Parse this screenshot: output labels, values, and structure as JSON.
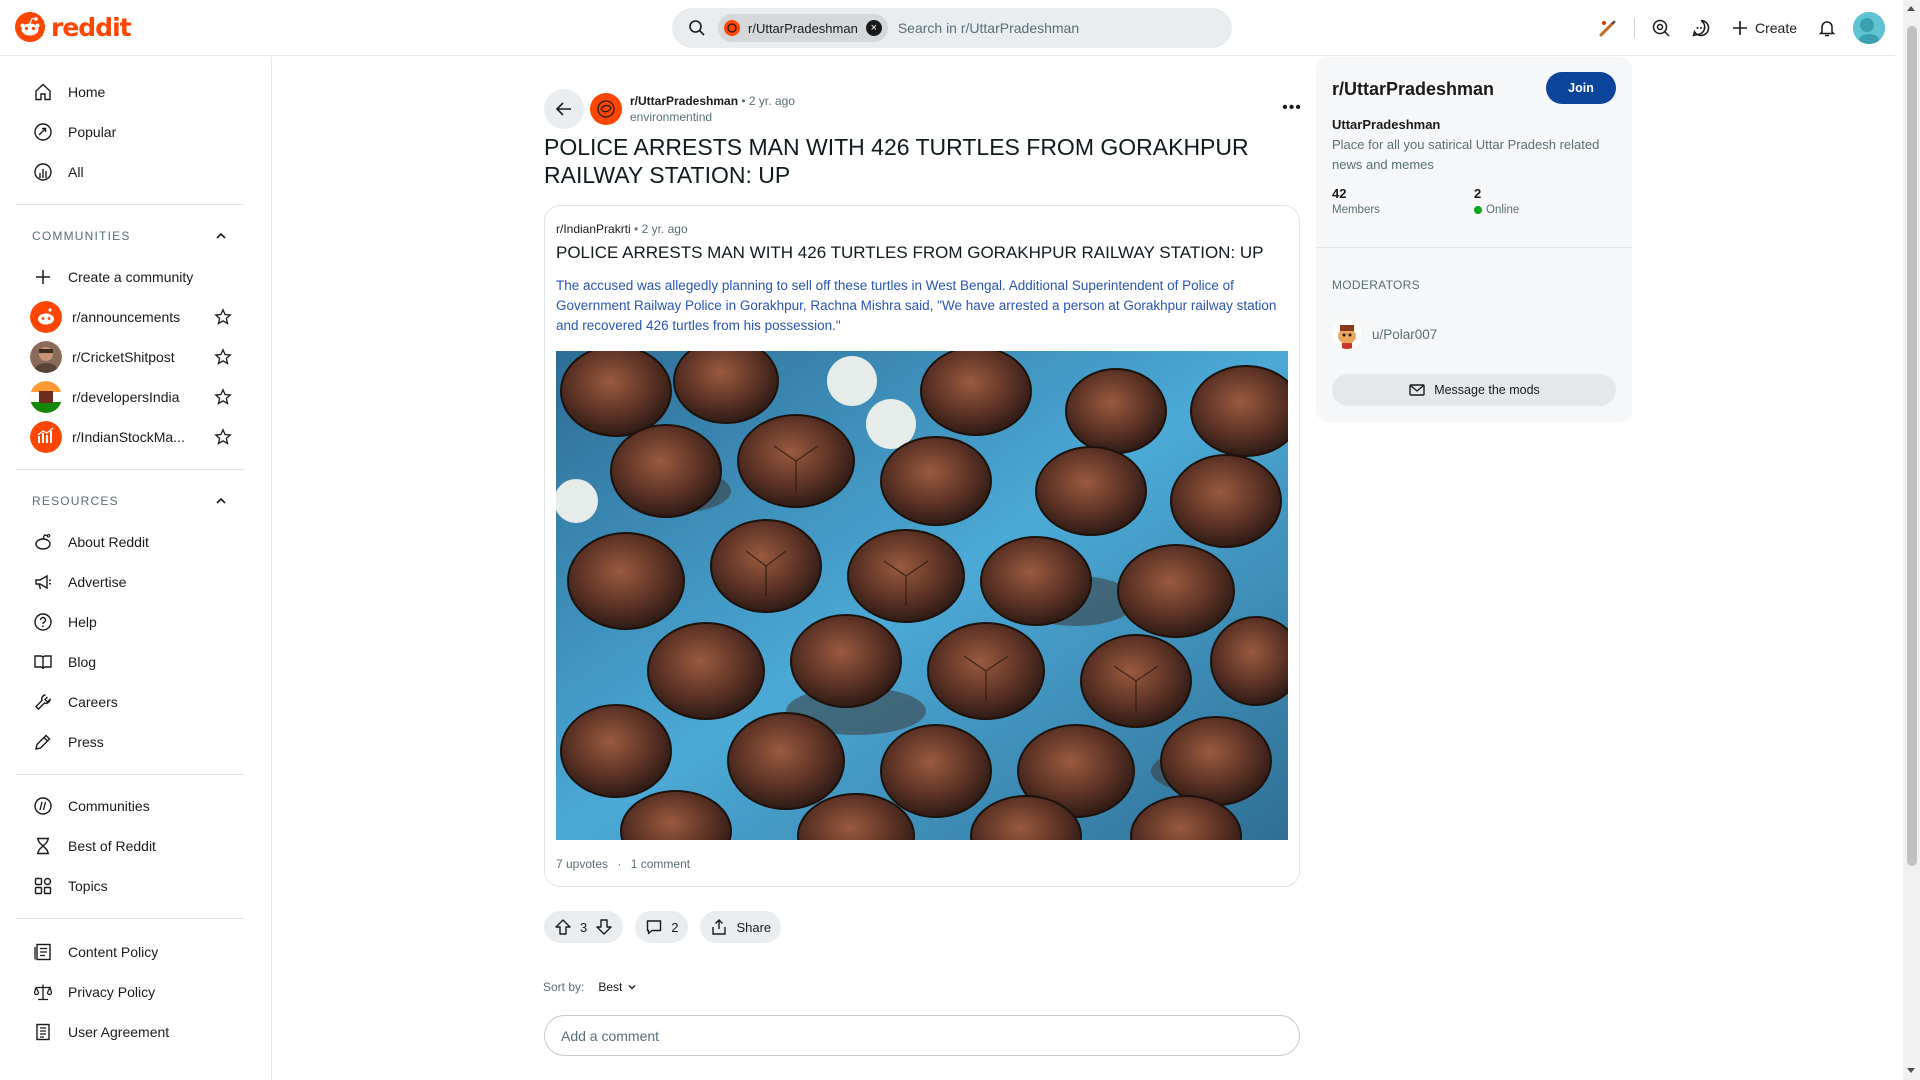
{
  "header": {
    "logo_text": "reddit",
    "search": {
      "chip_label": "r/UttarPradeshman",
      "placeholder": "Search in r/UttarPradeshman"
    },
    "create_label": "Create",
    "brand_color": "#ff4500"
  },
  "sidebar": {
    "nav": [
      {
        "label": "Home",
        "icon": "home-icon"
      },
      {
        "label": "Popular",
        "icon": "popular-icon"
      },
      {
        "label": "All",
        "icon": "all-icon"
      }
    ],
    "communities_heading": "COMMUNITIES",
    "create_community": "Create a community",
    "communities": [
      {
        "label": "r/announcements"
      },
      {
        "label": "r/CricketShitpost"
      },
      {
        "label": "r/developersIndia"
      },
      {
        "label": "r/IndianStockMa..."
      }
    ],
    "resources_heading": "RESOURCES",
    "resources": [
      {
        "label": "About Reddit",
        "icon": "reddit-icon"
      },
      {
        "label": "Advertise",
        "icon": "megaphone-icon"
      },
      {
        "label": "Help",
        "icon": "help-icon"
      },
      {
        "label": "Blog",
        "icon": "book-icon"
      },
      {
        "label": "Careers",
        "icon": "wrench-icon"
      },
      {
        "label": "Press",
        "icon": "pen-icon"
      }
    ],
    "more": [
      {
        "label": "Communities",
        "icon": "communities-icon"
      },
      {
        "label": "Best of Reddit",
        "icon": "hourglass-icon"
      },
      {
        "label": "Topics",
        "icon": "topics-icon"
      }
    ],
    "policies": [
      {
        "label": "Content Policy",
        "icon": "policy-icon"
      },
      {
        "label": "Privacy Policy",
        "icon": "scale-icon"
      },
      {
        "label": "User Agreement",
        "icon": "agreement-icon"
      }
    ]
  },
  "post": {
    "subreddit": "r/UttarPradeshman",
    "time": "• 2 yr. ago",
    "author": "environmentind",
    "title": "POLICE ARRESTS MAN WITH 426 TURTLES FROM GORAKHPUR RAILWAY STATION: UP",
    "crosspost": {
      "subreddit": "r/IndianPrakrti",
      "time": "• 2 yr. ago",
      "title": "POLICE ARRESTS MAN WITH 426 TURTLES FROM GORAKHPUR RAILWAY STATION: UP",
      "body": "The accused was allegedly planning to sell off these turtles in West Bengal. Additional Superintendent of Police of Government Railway Police in Gorakhpur, Rachna Mishra said, \"We have arrested a person at Gorakhpur railway station and recovered 426 turtles from his possession.\"",
      "upvotes": "7 upvotes",
      "separator": "·",
      "comments": "1 comment"
    },
    "votes": "3",
    "comment_count": "2",
    "share_label": "Share",
    "sort_label": "Sort by:",
    "sort_value": "Best",
    "add_comment_placeholder": "Add a comment"
  },
  "community_panel": {
    "title": "r/UttarPradeshman",
    "join_label": "Join",
    "name": "UttarPradeshman",
    "description": "Place for all you satirical Uttar Pradesh related news and memes",
    "members_count": "42",
    "members_label": "Members",
    "online_count": "2",
    "online_label": "Online",
    "moderators_heading": "MODERATORS",
    "moderator": "u/Polar007",
    "message_mods_label": "Message the mods",
    "join_color": "#0a449b"
  }
}
